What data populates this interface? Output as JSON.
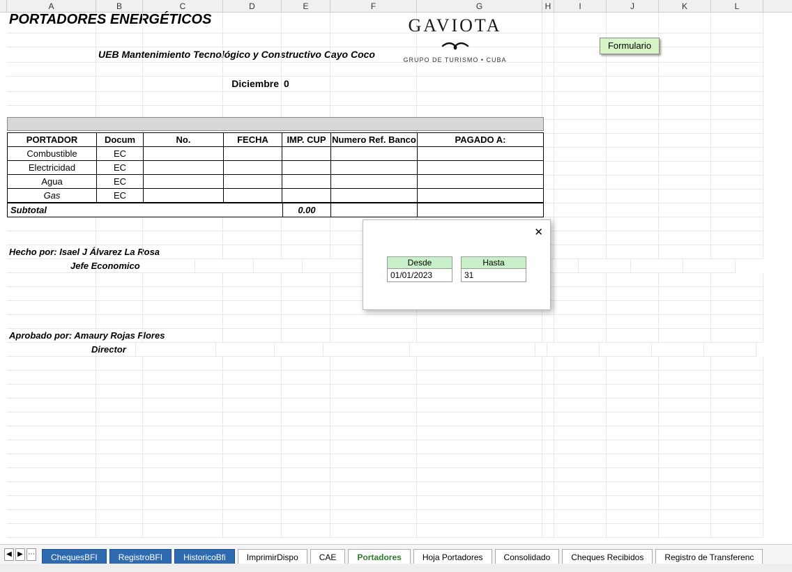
{
  "title": "PORTADORES ENERGÉTICOS",
  "subtitle": "UEB Mantenimiento Tecnológico y Constructivo Cayo Coco",
  "month": "Diciembre",
  "month_val": "0",
  "columns": [
    "A",
    "B",
    "C",
    "D",
    "E",
    "F",
    "G",
    "H",
    "I",
    "J",
    "K",
    "L"
  ],
  "form_button": "Formulario",
  "logo": {
    "name": "GAVIOTA",
    "tagline": "GRUPO DE TURISMO  •  CUBA"
  },
  "table": {
    "headers": [
      "PORTADOR",
      "Docum",
      "No.",
      "FECHA",
      "IMP. CUP",
      "Numero Ref. Banco",
      "PAGADO A:"
    ],
    "rows": [
      {
        "portador": "Combustible",
        "docum": "EC",
        "no": "",
        "fecha": "",
        "imp": "",
        "ref": "",
        "pagado": ""
      },
      {
        "portador": "Electricidad",
        "docum": "EC",
        "no": "",
        "fecha": "",
        "imp": "",
        "ref": "",
        "pagado": ""
      },
      {
        "portador": "Agua",
        "docum": "EC",
        "no": "",
        "fecha": "",
        "imp": "",
        "ref": "",
        "pagado": ""
      },
      {
        "portador": "Gas",
        "docum": "EC",
        "no": "",
        "fecha": "",
        "imp": "",
        "ref": "",
        "pagado": ""
      }
    ],
    "subtotal_label": "Subtotal",
    "subtotal_value": "0.00"
  },
  "signatures": {
    "hecho_label": "Hecho por: Isael J Álvarez La Rosa",
    "hecho_role": "Jefe Economico",
    "aprobado_label": "Aprobado por: Amaury Rojas Flores",
    "aprobado_role": "Director"
  },
  "modal": {
    "desde_label": "Desde",
    "hasta_label": "Hasta",
    "desde_value": "01/01/2023",
    "hasta_value": "31"
  },
  "tabs": {
    "nav_prev": "◀",
    "nav_next": "▶",
    "items": [
      {
        "label": "ChequesBFI",
        "style": "blue"
      },
      {
        "label": "RegistroBFI",
        "style": "blue"
      },
      {
        "label": "HistoricoBfi",
        "style": "blue"
      },
      {
        "label": "ImprimirDispo",
        "style": ""
      },
      {
        "label": "CAE",
        "style": ""
      },
      {
        "label": "Portadores",
        "style": "active"
      },
      {
        "label": "Hoja Portadores",
        "style": ""
      },
      {
        "label": "Consolidado",
        "style": ""
      },
      {
        "label": "Cheques Recibidos",
        "style": ""
      },
      {
        "label": "Registro de Transferenc",
        "style": ""
      }
    ]
  }
}
